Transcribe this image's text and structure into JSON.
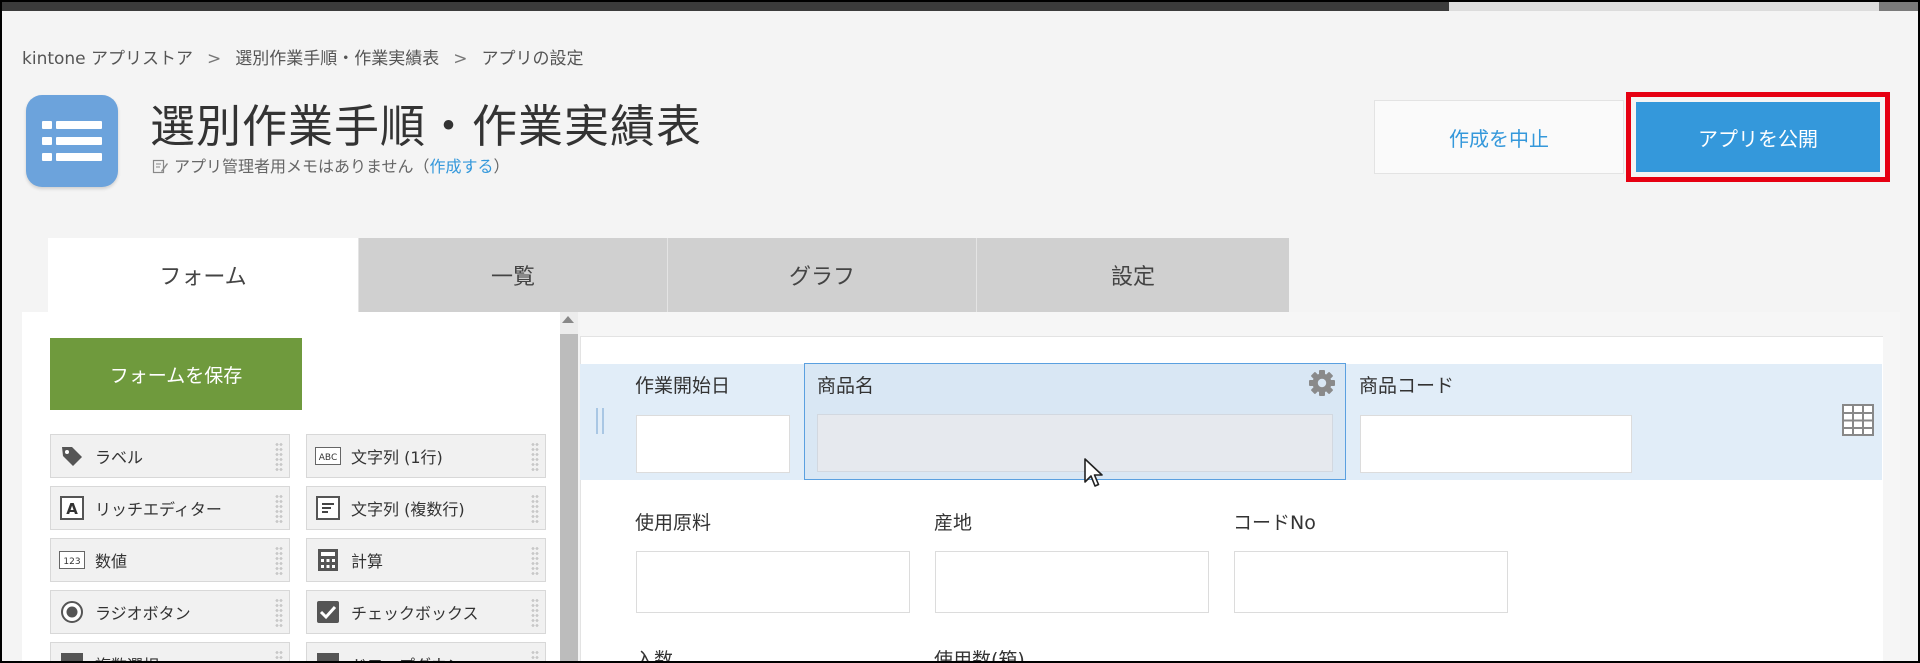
{
  "breadcrumb": {
    "items": [
      "kintone アプリストア",
      "選別作業手順・作業実績表",
      "アプリの設定"
    ],
    "separator": ">"
  },
  "app": {
    "title": "選別作業手順・作業実績表",
    "memo_text": "アプリ管理者用メモはありません（",
    "memo_link": "作成する",
    "memo_close": "）",
    "icon": "list-app-icon",
    "icon_color": "#6ca3dc"
  },
  "header_buttons": {
    "cancel_label": "作成を中止",
    "publish_label": "アプリを公開"
  },
  "tabs": [
    {
      "label": "フォーム",
      "active": true
    },
    {
      "label": "一覧",
      "active": false
    },
    {
      "label": "グラフ",
      "active": false
    },
    {
      "label": "設定",
      "active": false
    }
  ],
  "palette": {
    "save_label": "フォームを保存",
    "items": [
      {
        "label": "ラベル",
        "icon": "tag-icon"
      },
      {
        "label": "文字列 (1行)",
        "icon": "abc-text-icon"
      },
      {
        "label": "リッチエディター",
        "icon": "rich-editor-icon"
      },
      {
        "label": "文字列 (複数行)",
        "icon": "multiline-text-icon"
      },
      {
        "label": "数値",
        "icon": "number-icon"
      },
      {
        "label": "計算",
        "icon": "calculator-icon"
      },
      {
        "label": "ラジオボタン",
        "icon": "radio-icon"
      },
      {
        "label": "チェックボックス",
        "icon": "checkbox-icon"
      },
      {
        "label": "複数選択",
        "icon": "multi-select-icon"
      },
      {
        "label": "ドロップダウン",
        "icon": "dropdown-icon"
      }
    ]
  },
  "form": {
    "fields": [
      {
        "label": "作業開始日"
      },
      {
        "label": "商品名"
      },
      {
        "label": "商品コード"
      },
      {
        "label": "使用原料"
      },
      {
        "label": "産地"
      },
      {
        "label": "コードNo"
      },
      {
        "label": "入数"
      },
      {
        "label": "使用数(箱)"
      }
    ]
  },
  "colors": {
    "accent": "#3498db",
    "save_green": "#6f9a3d",
    "highlight_red": "#e60012",
    "selected_row": "#e1edf8"
  }
}
